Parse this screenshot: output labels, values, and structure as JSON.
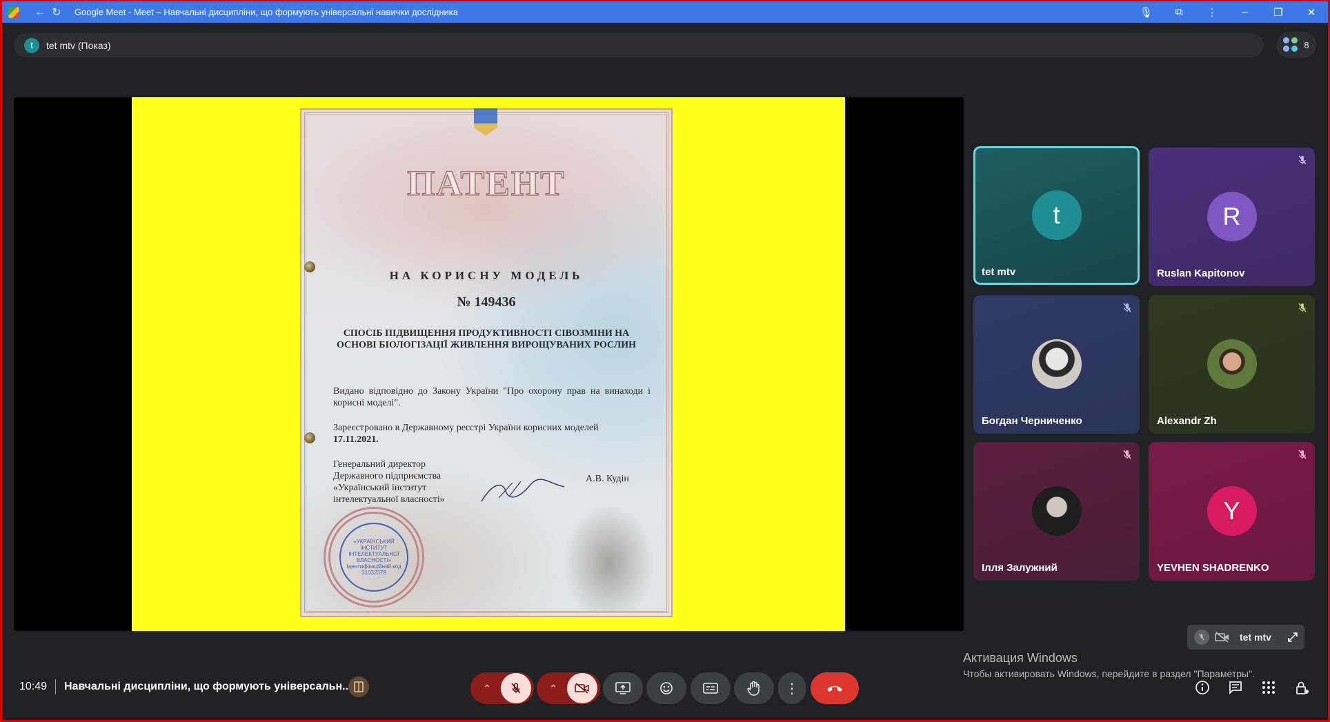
{
  "browser": {
    "title": "Google Meet - Meet – Навчальні дисципліни, що формують універсальні навички дослідника"
  },
  "presenter": {
    "initial": "t",
    "label": "tet mtv (Показ)"
  },
  "participants_count": "8",
  "slide": {
    "title": "ПАТЕНТ",
    "subtitle": "НА КОРИСНУ МОДЕЛЬ",
    "number": "№ 149436",
    "heading": "СПОСІБ ПІДВИЩЕННЯ ПРОДУКТИВНОСТІ СІВОЗМІНИ НА ОСНОВІ БІОЛОГІЗАЦІЇ ЖИВЛЕННЯ ВИРОЩУВАНИХ РОСЛИН",
    "para1": "Видано відповідно до Закону України \"Про охорону прав на винаходи і корисні моделі\".",
    "para2": "Зареєстровано в Державному реєстрі України корисних моделей",
    "date": "17.11.2021.",
    "director_line1": "Генеральний директор",
    "director_line2": "Державного підприємства",
    "director_line3": "«Український інститут",
    "director_line4": "інтелектуальної власності»",
    "signer": "А.В. Кудін",
    "seal_line1": "«УКРАЇНСЬКИЙ",
    "seal_line2": "ІНСТИТУТ",
    "seal_line3": "ІНТЕЛЕКТУАЛЬНОЇ",
    "seal_line4": "ВЛАСНОСТІ»",
    "seal_line5": "Ідентифікаційний код",
    "seal_code": "31032378"
  },
  "tiles": [
    {
      "name": "tet mtv",
      "initial": "t",
      "color": "#1e8e95",
      "muted": false
    },
    {
      "name": "Ruslan Kapitonov",
      "initial": "R",
      "color": "#7e57c2",
      "muted": true
    },
    {
      "name": "Богдан Черниченко",
      "initial": "",
      "color": "",
      "muted": true
    },
    {
      "name": "Alexandr Zh",
      "initial": "",
      "color": "",
      "muted": false
    },
    {
      "name": "Ілля Залужний",
      "initial": "",
      "color": "",
      "muted": true
    },
    {
      "name": "YEVHEN SHADRENKO",
      "initial": "Y",
      "color": "#d81b60",
      "muted": true
    }
  ],
  "self_view": {
    "name": "tet mtv"
  },
  "watermark": {
    "line1": "Активация Windows",
    "line2": "Чтобы активировать Windows, перейдите в раздел \"Параметры\"."
  },
  "bottom": {
    "time": "10:49",
    "meeting_title": "Навчальні дисципліни, що формують універсальн..."
  }
}
